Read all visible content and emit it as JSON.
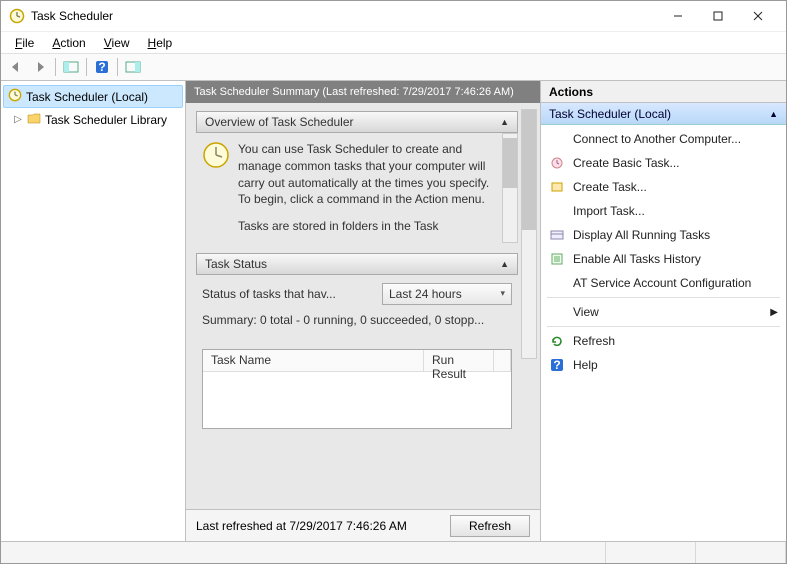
{
  "window": {
    "title": "Task Scheduler"
  },
  "menus": {
    "file": "File",
    "action": "Action",
    "view": "View",
    "help": "Help"
  },
  "tree": {
    "root": "Task Scheduler (Local)",
    "library": "Task Scheduler Library"
  },
  "center": {
    "header": "Task Scheduler Summary (Last refreshed: 7/29/2017 7:46:26 AM)",
    "overview_title": "Overview of Task Scheduler",
    "overview_text": "You can use Task Scheduler to create and manage common tasks that your computer will carry out automatically at the times you specify. To begin, click a command in the Action menu.",
    "overview_more": "Tasks are stored in folders in the Task",
    "taskstatus_title": "Task Status",
    "status_label": "Status of tasks that hav...",
    "dropdown_value": "Last 24 hours",
    "summary": "Summary: 0 total - 0 running, 0 succeeded, 0 stopp...",
    "col_taskname": "Task Name",
    "col_runresult": "Run Result",
    "footer": "Last refreshed at 7/29/2017 7:46:26 AM",
    "refresh_btn": "Refresh"
  },
  "actions": {
    "header": "Actions",
    "group": "Task Scheduler (Local)",
    "items": {
      "connect": "Connect to Another Computer...",
      "create_basic": "Create Basic Task...",
      "create_task": "Create Task...",
      "import": "Import Task...",
      "display_running": "Display All Running Tasks",
      "enable_history": "Enable All Tasks History",
      "at_config": "AT Service Account Configuration",
      "view": "View",
      "refresh": "Refresh",
      "help": "Help"
    }
  }
}
